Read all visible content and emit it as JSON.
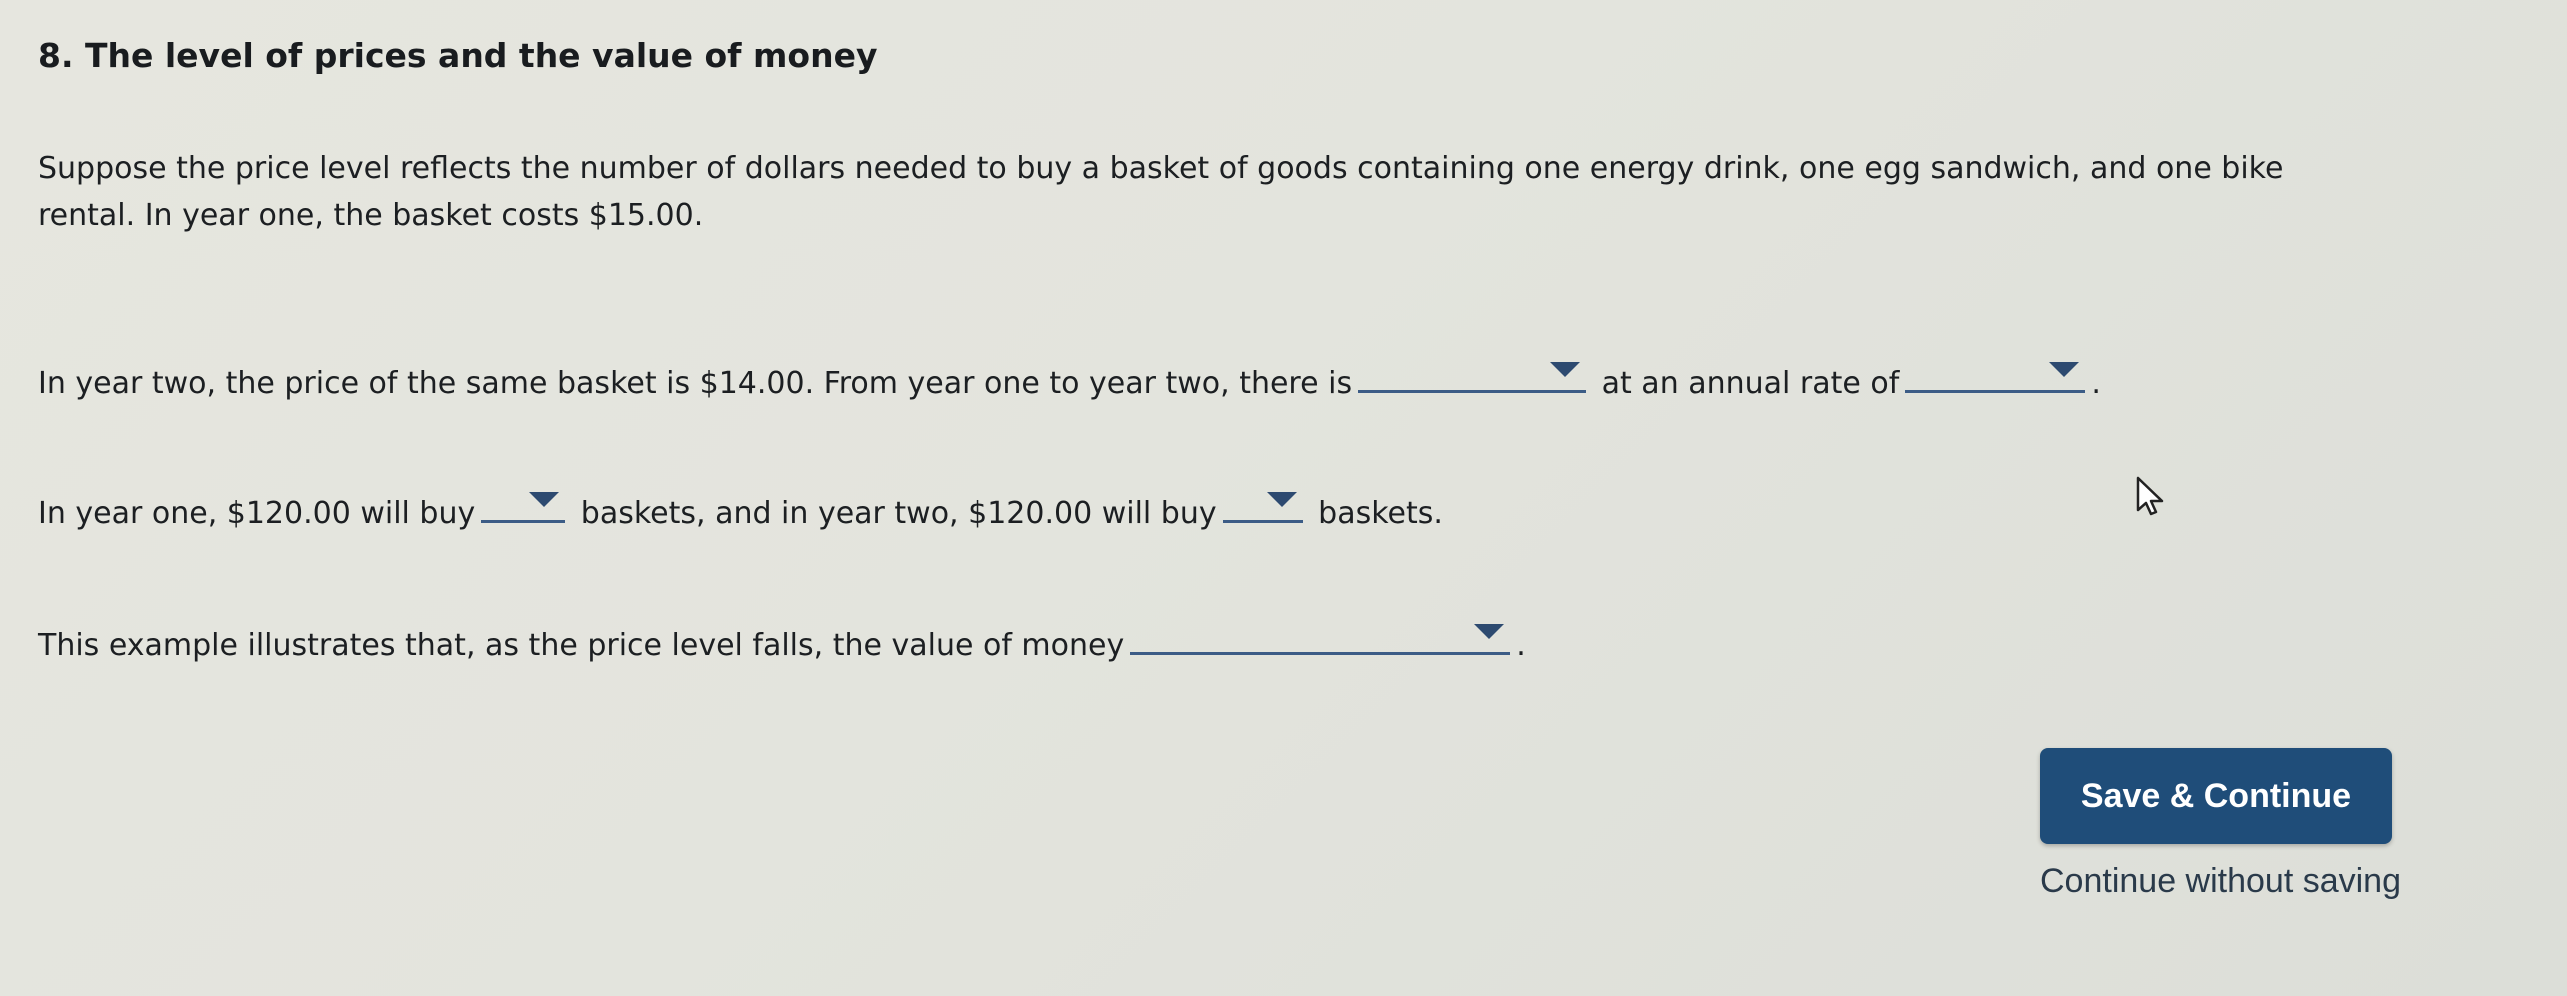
{
  "question": {
    "title": "8. The level of prices and the value of money"
  },
  "intro": {
    "line1": "Suppose the price level reflects the number of dollars needed to buy a basket of goods containing one energy drink, one egg sandwich, and one bike",
    "line2": "rental. In year one, the basket costs $15.00."
  },
  "year_two": {
    "text_before": "In year two, the price of the same basket is $14.00. From year one to year two, there is",
    "text_middle": "at an annual rate of",
    "text_after": ".",
    "change_dropdown_value": "",
    "rate_dropdown_value": ""
  },
  "year_one": {
    "text_before": "In year one, $120.00 will buy",
    "text_middle": "baskets, and in year two, $120.00 will buy",
    "text_after": "baskets.",
    "year_one_baskets_value": "",
    "year_two_baskets_value": ""
  },
  "example": {
    "text_before": "This example illustrates that, as the price level falls, the value of money",
    "text_after": ".",
    "value_dropdown_value": ""
  },
  "actions": {
    "save_label": "Save & Continue",
    "continue_label": "Continue without saving"
  },
  "colors": {
    "button_bg": "#1f4d79",
    "dropdown_accent": "#2d4a70",
    "background": "#e3e4dd"
  },
  "icons": {
    "dropdown": "caret-down-icon",
    "cursor": "mouse-cursor-icon"
  }
}
